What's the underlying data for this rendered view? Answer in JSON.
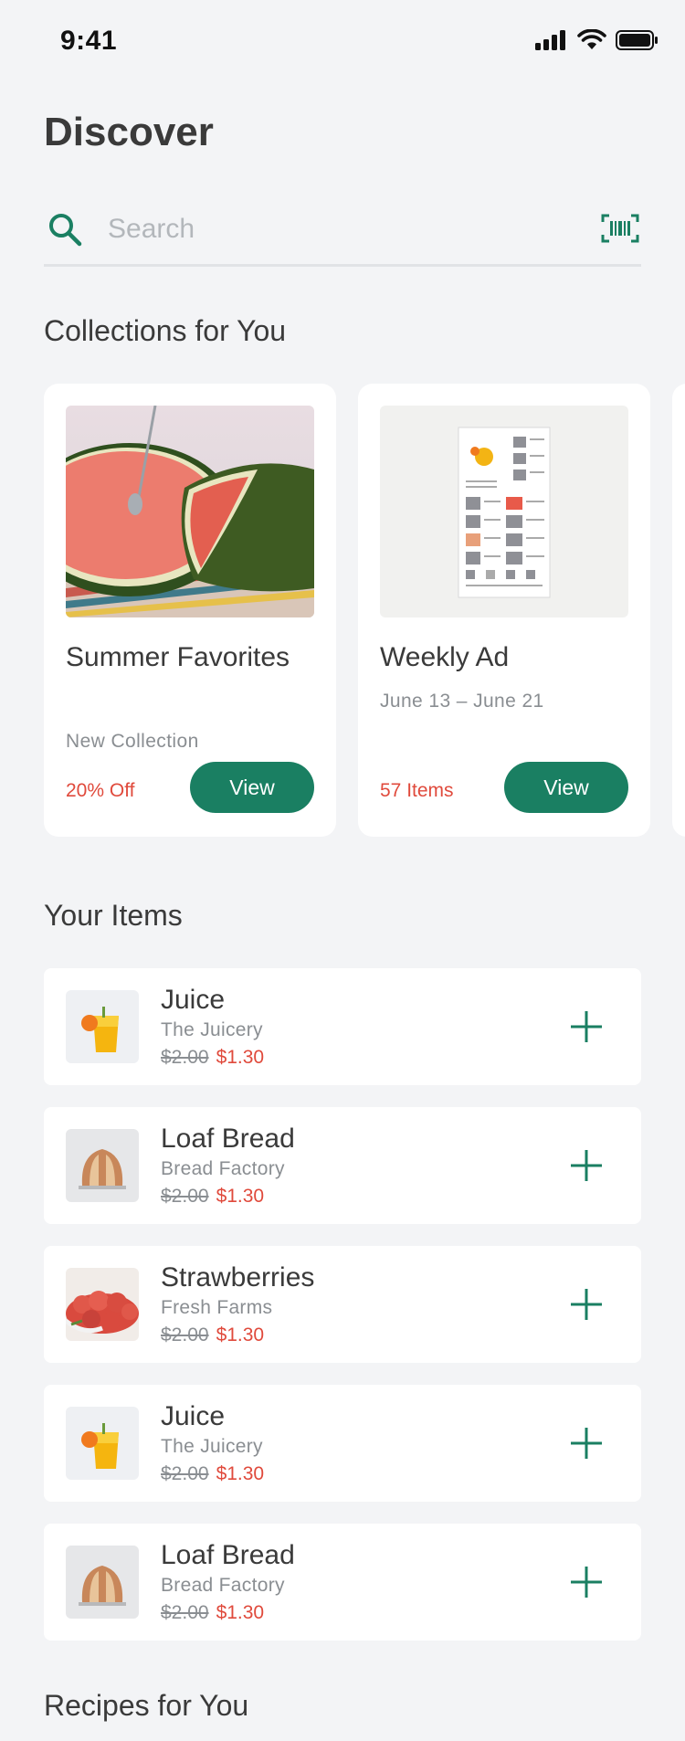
{
  "status_bar": {
    "time": "9:41"
  },
  "header": {
    "title": "Discover"
  },
  "search": {
    "placeholder": "Search"
  },
  "collections": {
    "heading": "Collections for You",
    "cards": [
      {
        "title": "Summer Favorites",
        "subtitle": "New Collection",
        "footer": "20% Off",
        "button_label": "View"
      },
      {
        "title": "Weekly Ad",
        "subtitle": "June 13 – June 21",
        "footer": "57 Items",
        "button_label": "View"
      }
    ]
  },
  "your_items": {
    "heading": "Your Items",
    "items": [
      {
        "name": "Juice",
        "vendor": "The Juicery",
        "old_price": "$2.00",
        "new_price": "$1.30",
        "thumb": "juice"
      },
      {
        "name": "Loaf Bread",
        "vendor": "Bread Factory",
        "old_price": "$2.00",
        "new_price": "$1.30",
        "thumb": "bread"
      },
      {
        "name": "Strawberries",
        "vendor": "Fresh Farms",
        "old_price": "$2.00",
        "new_price": "$1.30",
        "thumb": "strawberries"
      },
      {
        "name": "Juice",
        "vendor": "The Juicery",
        "old_price": "$2.00",
        "new_price": "$1.30",
        "thumb": "juice"
      },
      {
        "name": "Loaf Bread",
        "vendor": "Bread Factory",
        "old_price": "$2.00",
        "new_price": "$1.30",
        "thumb": "bread"
      }
    ]
  },
  "recipes": {
    "heading": "Recipes for You"
  },
  "colors": {
    "accent": "#1a7f62",
    "sale": "#e04a3c",
    "background": "#f3f4f6"
  }
}
